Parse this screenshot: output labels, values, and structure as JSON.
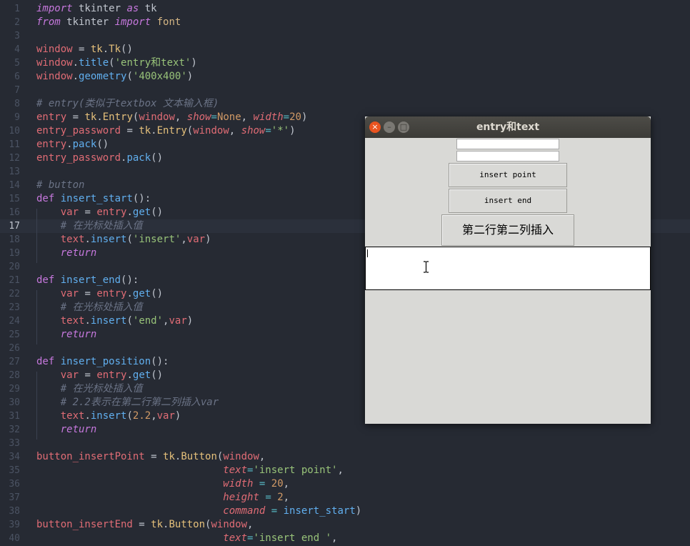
{
  "editor": {
    "current_line": "17",
    "lines": [
      {
        "n": "1",
        "tokens": [
          [
            "kw",
            "import"
          ],
          [
            "id",
            " tkinter "
          ],
          [
            "kw",
            "as"
          ],
          [
            "id",
            " tk"
          ]
        ]
      },
      {
        "n": "2",
        "tokens": [
          [
            "kw",
            "from"
          ],
          [
            "id",
            " tkinter "
          ],
          [
            "kw",
            "import"
          ],
          [
            "mod2",
            " font"
          ]
        ]
      },
      {
        "n": "3",
        "tokens": []
      },
      {
        "n": "4",
        "tokens": [
          [
            "var",
            "window"
          ],
          [
            "id",
            " = "
          ],
          [
            "mod",
            "tk"
          ],
          [
            "id",
            "."
          ],
          [
            "mod",
            "Tk"
          ],
          [
            "id",
            "()"
          ]
        ]
      },
      {
        "n": "5",
        "tokens": [
          [
            "var",
            "window"
          ],
          [
            "id",
            "."
          ],
          [
            "fn",
            "title"
          ],
          [
            "id",
            "("
          ],
          [
            "str",
            "'entry和text'"
          ],
          [
            "id",
            ")"
          ]
        ]
      },
      {
        "n": "6",
        "tokens": [
          [
            "var",
            "window"
          ],
          [
            "id",
            "."
          ],
          [
            "fn",
            "geometry"
          ],
          [
            "id",
            "("
          ],
          [
            "str",
            "'400x400'"
          ],
          [
            "id",
            ")"
          ]
        ]
      },
      {
        "n": "7",
        "tokens": []
      },
      {
        "n": "8",
        "tokens": [
          [
            "cm",
            "# entry(类似于textbox 文本输入框)"
          ]
        ]
      },
      {
        "n": "9",
        "tokens": [
          [
            "var",
            "entry"
          ],
          [
            "id",
            " = "
          ],
          [
            "mod",
            "tk"
          ],
          [
            "id",
            "."
          ],
          [
            "mod",
            "Entry"
          ],
          [
            "id",
            "("
          ],
          [
            "var",
            "window"
          ],
          [
            "id",
            ", "
          ],
          [
            "param",
            "show"
          ],
          [
            "op",
            "="
          ],
          [
            "none",
            "None"
          ],
          [
            "id",
            ", "
          ],
          [
            "param",
            "width"
          ],
          [
            "op",
            "="
          ],
          [
            "num",
            "20"
          ],
          [
            "id",
            ")"
          ]
        ]
      },
      {
        "n": "10",
        "tokens": [
          [
            "var",
            "entry_password"
          ],
          [
            "id",
            " = "
          ],
          [
            "mod",
            "tk"
          ],
          [
            "id",
            "."
          ],
          [
            "mod",
            "Entry"
          ],
          [
            "id",
            "("
          ],
          [
            "var",
            "window"
          ],
          [
            "id",
            ", "
          ],
          [
            "param",
            "show"
          ],
          [
            "op",
            "="
          ],
          [
            "str",
            "'*'"
          ],
          [
            "id",
            ")"
          ]
        ]
      },
      {
        "n": "11",
        "tokens": [
          [
            "var",
            "entry"
          ],
          [
            "id",
            "."
          ],
          [
            "fn",
            "pack"
          ],
          [
            "id",
            "()"
          ]
        ]
      },
      {
        "n": "12",
        "tokens": [
          [
            "var",
            "entry_password"
          ],
          [
            "id",
            "."
          ],
          [
            "fn",
            "pack"
          ],
          [
            "id",
            "()"
          ]
        ]
      },
      {
        "n": "13",
        "tokens": []
      },
      {
        "n": "14",
        "tokens": [
          [
            "cm",
            "# button"
          ]
        ]
      },
      {
        "n": "15",
        "tokens": [
          [
            "kw2",
            "def"
          ],
          [
            "fn",
            " insert_start"
          ],
          [
            "id",
            "():"
          ]
        ]
      },
      {
        "n": "16",
        "tokens": [
          [
            "id",
            "    "
          ],
          [
            "var",
            "var"
          ],
          [
            "id",
            " = "
          ],
          [
            "var",
            "entry"
          ],
          [
            "id",
            "."
          ],
          [
            "fn",
            "get"
          ],
          [
            "id",
            "()"
          ]
        ]
      },
      {
        "n": "17",
        "tokens": [
          [
            "id",
            "    "
          ],
          [
            "cm",
            "# 在光标处插入值"
          ]
        ]
      },
      {
        "n": "18",
        "tokens": [
          [
            "id",
            "    "
          ],
          [
            "var",
            "text"
          ],
          [
            "id",
            "."
          ],
          [
            "fn",
            "insert"
          ],
          [
            "id",
            "("
          ],
          [
            "str",
            "'insert'"
          ],
          [
            "id",
            ","
          ],
          [
            "var",
            "var"
          ],
          [
            "id",
            ")"
          ]
        ]
      },
      {
        "n": "19",
        "tokens": [
          [
            "id",
            "    "
          ],
          [
            "kw",
            "return"
          ]
        ]
      },
      {
        "n": "20",
        "tokens": []
      },
      {
        "n": "21",
        "tokens": [
          [
            "kw2",
            "def"
          ],
          [
            "fn",
            " insert_end"
          ],
          [
            "id",
            "():"
          ]
        ]
      },
      {
        "n": "22",
        "tokens": [
          [
            "id",
            "    "
          ],
          [
            "var",
            "var"
          ],
          [
            "id",
            " = "
          ],
          [
            "var",
            "entry"
          ],
          [
            "id",
            "."
          ],
          [
            "fn",
            "get"
          ],
          [
            "id",
            "()"
          ]
        ]
      },
      {
        "n": "23",
        "tokens": [
          [
            "id",
            "    "
          ],
          [
            "cm",
            "# 在光标处插入值"
          ]
        ]
      },
      {
        "n": "24",
        "tokens": [
          [
            "id",
            "    "
          ],
          [
            "var",
            "text"
          ],
          [
            "id",
            "."
          ],
          [
            "fn",
            "insert"
          ],
          [
            "id",
            "("
          ],
          [
            "str",
            "'end'"
          ],
          [
            "id",
            ","
          ],
          [
            "var",
            "var"
          ],
          [
            "id",
            ")"
          ]
        ]
      },
      {
        "n": "25",
        "tokens": [
          [
            "id",
            "    "
          ],
          [
            "kw",
            "return"
          ]
        ]
      },
      {
        "n": "26",
        "tokens": []
      },
      {
        "n": "27",
        "tokens": [
          [
            "kw2",
            "def"
          ],
          [
            "fn",
            " insert_position"
          ],
          [
            "id",
            "():"
          ]
        ]
      },
      {
        "n": "28",
        "tokens": [
          [
            "id",
            "    "
          ],
          [
            "var",
            "var"
          ],
          [
            "id",
            " = "
          ],
          [
            "var",
            "entry"
          ],
          [
            "id",
            "."
          ],
          [
            "fn",
            "get"
          ],
          [
            "id",
            "()"
          ]
        ]
      },
      {
        "n": "29",
        "tokens": [
          [
            "id",
            "    "
          ],
          [
            "cm",
            "# 在光标处插入值"
          ]
        ]
      },
      {
        "n": "30",
        "tokens": [
          [
            "id",
            "    "
          ],
          [
            "cm",
            "# 2.2表示在第二行第二列插入var"
          ]
        ]
      },
      {
        "n": "31",
        "tokens": [
          [
            "id",
            "    "
          ],
          [
            "var",
            "text"
          ],
          [
            "id",
            "."
          ],
          [
            "fn",
            "insert"
          ],
          [
            "id",
            "("
          ],
          [
            "num",
            "2.2"
          ],
          [
            "id",
            ","
          ],
          [
            "var",
            "var"
          ],
          [
            "id",
            ")"
          ]
        ]
      },
      {
        "n": "32",
        "tokens": [
          [
            "id",
            "    "
          ],
          [
            "kw",
            "return"
          ]
        ]
      },
      {
        "n": "33",
        "tokens": []
      },
      {
        "n": "34",
        "tokens": [
          [
            "var",
            "button_insertPoint"
          ],
          [
            "id",
            " = "
          ],
          [
            "mod",
            "tk"
          ],
          [
            "id",
            "."
          ],
          [
            "mod",
            "Button"
          ],
          [
            "id",
            "("
          ],
          [
            "var",
            "window"
          ],
          [
            "id",
            ","
          ]
        ]
      },
      {
        "n": "35",
        "tokens": [
          [
            "id",
            "                               "
          ],
          [
            "param",
            "text"
          ],
          [
            "op",
            "="
          ],
          [
            "str",
            "'insert point'"
          ],
          [
            "id",
            ","
          ]
        ]
      },
      {
        "n": "36",
        "tokens": [
          [
            "id",
            "                               "
          ],
          [
            "param",
            "width"
          ],
          [
            "id",
            " "
          ],
          [
            "op",
            "="
          ],
          [
            "id",
            " "
          ],
          [
            "num",
            "20"
          ],
          [
            "id",
            ","
          ]
        ]
      },
      {
        "n": "37",
        "tokens": [
          [
            "id",
            "                               "
          ],
          [
            "param",
            "height"
          ],
          [
            "id",
            " "
          ],
          [
            "op",
            "="
          ],
          [
            "id",
            " "
          ],
          [
            "num",
            "2"
          ],
          [
            "id",
            ","
          ]
        ]
      },
      {
        "n": "38",
        "tokens": [
          [
            "id",
            "                               "
          ],
          [
            "param",
            "command"
          ],
          [
            "id",
            " "
          ],
          [
            "op",
            "="
          ],
          [
            "id",
            " "
          ],
          [
            "fn",
            "insert_start"
          ],
          [
            "id",
            ")"
          ]
        ]
      },
      {
        "n": "39",
        "tokens": [
          [
            "var",
            "button_insertEnd"
          ],
          [
            "id",
            " = "
          ],
          [
            "mod",
            "tk"
          ],
          [
            "id",
            "."
          ],
          [
            "mod",
            "Button"
          ],
          [
            "id",
            "("
          ],
          [
            "var",
            "window"
          ],
          [
            "id",
            ","
          ]
        ]
      },
      {
        "n": "40",
        "tokens": [
          [
            "id",
            "                               "
          ],
          [
            "param",
            "text"
          ],
          [
            "op",
            "="
          ],
          [
            "str",
            "'insert end '"
          ],
          [
            "id",
            ","
          ]
        ]
      }
    ]
  },
  "tk_window": {
    "title": "entry和text",
    "close_glyph": "×",
    "min_glyph": "–",
    "max_glyph": "□",
    "button_insert_point": "insert point",
    "button_insert_end": "insert end",
    "button_insert_position": "第二行第二列插入",
    "text_value": "",
    "entry_value": "",
    "entry_password_value": ""
  }
}
